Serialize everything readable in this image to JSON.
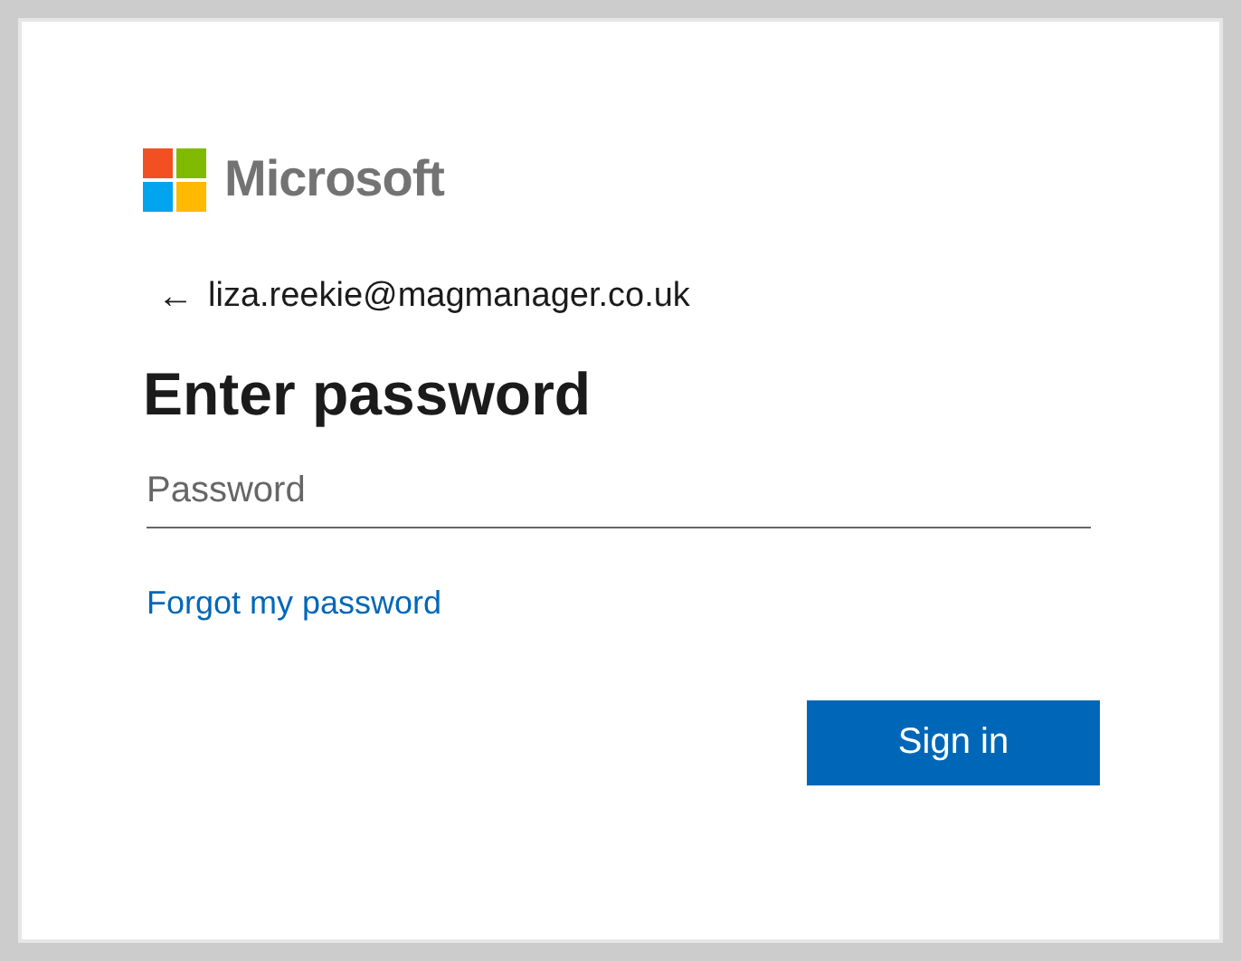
{
  "brand": {
    "name": "Microsoft"
  },
  "identity": {
    "back": "←",
    "email": "liza.reekie@magmanager.co.uk"
  },
  "title": "Enter password",
  "password_field": {
    "placeholder": "Password"
  },
  "forgot_link": "Forgot my password",
  "buttons": [
    "Sign in"
  ]
}
